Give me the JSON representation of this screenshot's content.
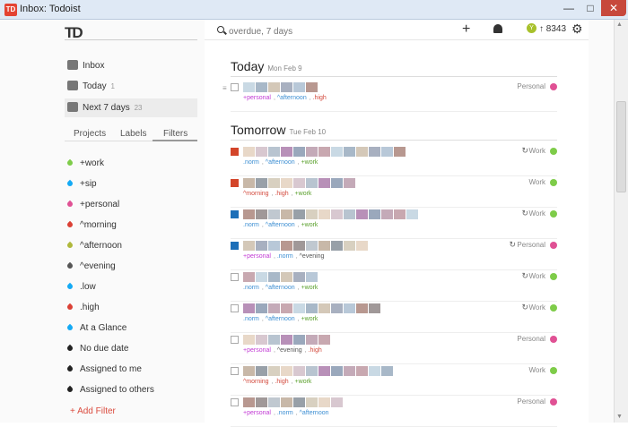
{
  "window": {
    "title": "Inbox: Todoist",
    "app_icon": "TD",
    "min": "—",
    "max": "□",
    "close": "✕"
  },
  "logo": "TD",
  "sidebar": {
    "nav": [
      {
        "label": "Inbox",
        "count": "",
        "icon": "inbox-icon"
      },
      {
        "label": "Today",
        "count": "1",
        "icon": "calendar-icon"
      },
      {
        "label": "Next 7 days",
        "count": "23",
        "icon": "calendar-week-icon"
      }
    ],
    "tabs": [
      "Projects",
      "Labels",
      "Filters"
    ],
    "active_tab": "Filters",
    "filters": [
      {
        "label": "+work",
        "color": "#7ecc49"
      },
      {
        "label": "+sip",
        "color": "#14aaf5"
      },
      {
        "label": "+personal",
        "color": "#e05194"
      },
      {
        "label": "^morning",
        "color": "#db4035"
      },
      {
        "label": "^afternoon",
        "color": "#afb83b"
      },
      {
        "label": "^evening",
        "color": "#555555"
      },
      {
        "label": ".low",
        "color": "#14aaf5"
      },
      {
        "label": ".high",
        "color": "#db4035"
      },
      {
        "label": "At a Glance",
        "color": "#14aaf5"
      },
      {
        "label": "No due date",
        "color": "#222222"
      },
      {
        "label": "Assigned to me",
        "color": "#222222"
      },
      {
        "label": "Assigned to others",
        "color": "#222222"
      }
    ],
    "add_filter": "+ Add Filter"
  },
  "header": {
    "search_placeholder": "overdue, 7 days",
    "plus": "+",
    "karma_icon": "Y",
    "karma": "↑ 8343",
    "gear": "⚙"
  },
  "recur_glyph": "↻",
  "drag_glyph": "≡",
  "sections": [
    {
      "title": "Today",
      "date": "Mon Feb 9",
      "tasks": [
        {
          "check_color": "",
          "labels": [
            [
              "+personal",
              "#c23bd4"
            ],
            [
              "^afternoon",
              "#3d8fd3"
            ],
            [
              ".high",
              "#d34a3d"
            ]
          ],
          "recurring": false,
          "project": "Personal",
          "project_color": "#e05194",
          "drag": true
        }
      ]
    },
    {
      "title": "Tomorrow",
      "date": "Tue Feb 10",
      "tasks": [
        {
          "check_color": "#d3452a",
          "labels": [
            [
              ".norm",
              "#3d8fd3"
            ],
            [
              "^afternoon",
              "#3d8fd3"
            ],
            [
              "+work",
              "#5aa02c"
            ]
          ],
          "recurring": true,
          "project": "Work",
          "project_color": "#7ecc49",
          "drag": false
        },
        {
          "check_color": "#d3452a",
          "labels": [
            [
              "^morning",
              "#d34a3d"
            ],
            [
              ".high",
              "#d34a3d"
            ],
            [
              "+work",
              "#5aa02c"
            ]
          ],
          "recurring": false,
          "project": "Work",
          "project_color": "#7ecc49",
          "drag": false
        },
        {
          "check_color": "#1d6fb8",
          "labels": [
            [
              ".norm",
              "#3d8fd3"
            ],
            [
              "^afternoon",
              "#3d8fd3"
            ],
            [
              "+work",
              "#5aa02c"
            ]
          ],
          "recurring": true,
          "project": "Work",
          "project_color": "#7ecc49",
          "drag": false
        },
        {
          "check_color": "#1d6fb8",
          "labels": [
            [
              "+personal",
              "#c23bd4"
            ],
            [
              ".norm",
              "#3d8fd3"
            ],
            [
              "^evening",
              "#555555"
            ]
          ],
          "recurring": true,
          "project": "Personal",
          "project_color": "#e05194",
          "drag": false
        },
        {
          "check_color": "",
          "labels": [
            [
              ".norm",
              "#3d8fd3"
            ],
            [
              "^afternoon",
              "#3d8fd3"
            ],
            [
              "+work",
              "#5aa02c"
            ]
          ],
          "recurring": true,
          "project": "Work",
          "project_color": "#7ecc49",
          "drag": false
        },
        {
          "check_color": "",
          "labels": [
            [
              ".norm",
              "#3d8fd3"
            ],
            [
              "^afternoon",
              "#3d8fd3"
            ],
            [
              "+work",
              "#5aa02c"
            ]
          ],
          "recurring": true,
          "project": "Work",
          "project_color": "#7ecc49",
          "drag": false
        },
        {
          "check_color": "",
          "labels": [
            [
              "+personal",
              "#c23bd4"
            ],
            [
              "^evening",
              "#555555"
            ],
            [
              ".high",
              "#d34a3d"
            ]
          ],
          "recurring": false,
          "project": "Personal",
          "project_color": "#e05194",
          "drag": false
        },
        {
          "check_color": "",
          "labels": [
            [
              "^morning",
              "#d34a3d"
            ],
            [
              ".high",
              "#d34a3d"
            ],
            [
              "+work",
              "#5aa02c"
            ]
          ],
          "recurring": false,
          "project": "Work",
          "project_color": "#7ecc49",
          "drag": false
        },
        {
          "check_color": "",
          "labels": [
            [
              "+personal",
              "#c23bd4"
            ],
            [
              ".norm",
              "#3d8fd3"
            ],
            [
              "^afternoon",
              "#3d8fd3"
            ]
          ],
          "recurring": false,
          "project": "Personal",
          "project_color": "#e05194",
          "drag": false
        }
      ]
    }
  ]
}
